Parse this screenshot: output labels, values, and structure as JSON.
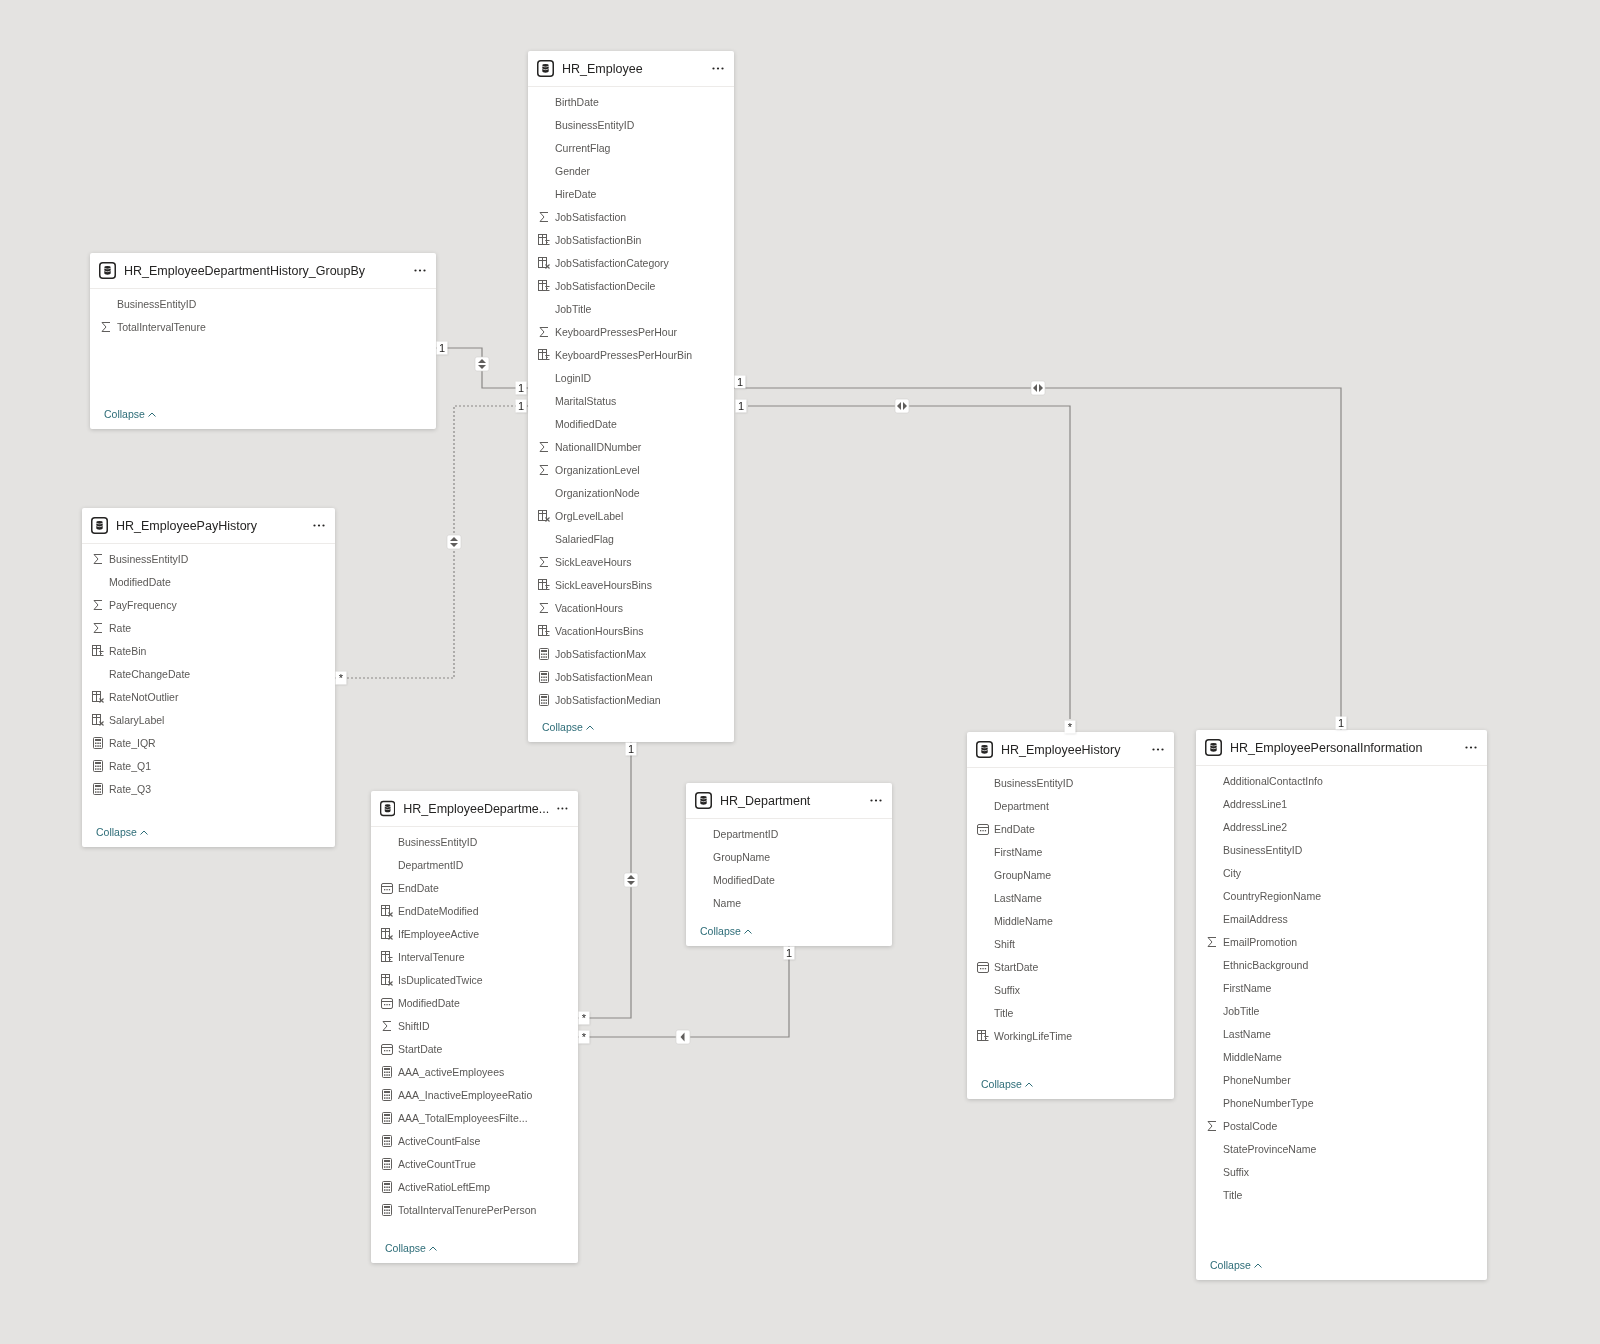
{
  "tables": [
    {
      "title": "HR_Employee",
      "collapse": "Collapse",
      "fields": [
        {
          "name": "BirthDate",
          "kind": "plain"
        },
        {
          "name": "BusinessEntityID",
          "kind": "plain"
        },
        {
          "name": "CurrentFlag",
          "kind": "plain"
        },
        {
          "name": "Gender",
          "kind": "plain"
        },
        {
          "name": "HireDate",
          "kind": "plain"
        },
        {
          "name": "JobSatisfaction",
          "kind": "sum"
        },
        {
          "name": "JobSatisfactionBin",
          "kind": "bin"
        },
        {
          "name": "JobSatisfactionCategory",
          "kind": "calc"
        },
        {
          "name": "JobSatisfactionDecile",
          "kind": "bin"
        },
        {
          "name": "JobTitle",
          "kind": "plain"
        },
        {
          "name": "KeyboardPressesPerHour",
          "kind": "sum"
        },
        {
          "name": "KeyboardPressesPerHourBin",
          "kind": "bin"
        },
        {
          "name": "LoginID",
          "kind": "plain"
        },
        {
          "name": "MaritalStatus",
          "kind": "plain"
        },
        {
          "name": "ModifiedDate",
          "kind": "plain"
        },
        {
          "name": "NationalIDNumber",
          "kind": "sum"
        },
        {
          "name": "OrganizationLevel",
          "kind": "sum"
        },
        {
          "name": "OrganizationNode",
          "kind": "plain"
        },
        {
          "name": "OrgLevelLabel",
          "kind": "calc"
        },
        {
          "name": "SalariedFlag",
          "kind": "plain"
        },
        {
          "name": "SickLeaveHours",
          "kind": "sum"
        },
        {
          "name": "SickLeaveHoursBins",
          "kind": "bin"
        },
        {
          "name": "VacationHours",
          "kind": "sum"
        },
        {
          "name": "VacationHoursBins",
          "kind": "bin"
        },
        {
          "name": "JobSatisfactionMax",
          "kind": "measure"
        },
        {
          "name": "JobSatisfactionMean",
          "kind": "measure"
        },
        {
          "name": "JobSatisfactionMedian",
          "kind": "measure"
        }
      ]
    },
    {
      "title": "HR_EmployeeDepartmentHistory_GroupBy",
      "collapse": "Collapse",
      "fields": [
        {
          "name": "BusinessEntityID",
          "kind": "plain"
        },
        {
          "name": "TotalIntervalTenure",
          "kind": "sum"
        }
      ]
    },
    {
      "title": "HR_EmployeePayHistory",
      "collapse": "Collapse",
      "fields": [
        {
          "name": "BusinessEntityID",
          "kind": "sum"
        },
        {
          "name": "ModifiedDate",
          "kind": "plain"
        },
        {
          "name": "PayFrequency",
          "kind": "sum"
        },
        {
          "name": "Rate",
          "kind": "sum"
        },
        {
          "name": "RateBin",
          "kind": "bin"
        },
        {
          "name": "RateChangeDate",
          "kind": "plain"
        },
        {
          "name": "RateNotOutlier",
          "kind": "calc"
        },
        {
          "name": "SalaryLabel",
          "kind": "calc"
        },
        {
          "name": "Rate_IQR",
          "kind": "measure"
        },
        {
          "name": "Rate_Q1",
          "kind": "measure"
        },
        {
          "name": "Rate_Q3",
          "kind": "measure"
        }
      ]
    },
    {
      "title": "HR_EmployeeDepartme...",
      "collapse": "Collapse",
      "fields": [
        {
          "name": "BusinessEntityID",
          "kind": "plain"
        },
        {
          "name": "DepartmentID",
          "kind": "plain"
        },
        {
          "name": "EndDate",
          "kind": "date"
        },
        {
          "name": "EndDateModified",
          "kind": "calc"
        },
        {
          "name": "IfEmployeeActive",
          "kind": "calc"
        },
        {
          "name": "IntervalTenure",
          "kind": "bin"
        },
        {
          "name": "IsDuplicatedTwice",
          "kind": "calc"
        },
        {
          "name": "ModifiedDate",
          "kind": "date"
        },
        {
          "name": "ShiftID",
          "kind": "sum"
        },
        {
          "name": "StartDate",
          "kind": "date"
        },
        {
          "name": "AAA_activeEmployees",
          "kind": "measure"
        },
        {
          "name": "AAA_InactiveEmployeeRatio",
          "kind": "measure"
        },
        {
          "name": "AAA_TotalEmployeesFilte...",
          "kind": "measure"
        },
        {
          "name": "ActiveCountFalse",
          "kind": "measure"
        },
        {
          "name": "ActiveCountTrue",
          "kind": "measure"
        },
        {
          "name": "ActiveRatioLeftEmp",
          "kind": "measure"
        },
        {
          "name": "TotalIntervalTenurePerPerson",
          "kind": "measure"
        }
      ]
    },
    {
      "title": "HR_Department",
      "collapse": "Collapse",
      "fields": [
        {
          "name": "DepartmentID",
          "kind": "plain"
        },
        {
          "name": "GroupName",
          "kind": "plain"
        },
        {
          "name": "ModifiedDate",
          "kind": "plain"
        },
        {
          "name": "Name",
          "kind": "plain"
        }
      ]
    },
    {
      "title": "HR_EmployeeHistory",
      "collapse": "Collapse",
      "fields": [
        {
          "name": "BusinessEntityID",
          "kind": "plain"
        },
        {
          "name": "Department",
          "kind": "plain"
        },
        {
          "name": "EndDate",
          "kind": "date"
        },
        {
          "name": "FirstName",
          "kind": "plain"
        },
        {
          "name": "GroupName",
          "kind": "plain"
        },
        {
          "name": "LastName",
          "kind": "plain"
        },
        {
          "name": "MiddleName",
          "kind": "plain"
        },
        {
          "name": "Shift",
          "kind": "plain"
        },
        {
          "name": "StartDate",
          "kind": "date"
        },
        {
          "name": "Suffix",
          "kind": "plain"
        },
        {
          "name": "Title",
          "kind": "plain"
        },
        {
          "name": "WorkingLifeTime",
          "kind": "bin"
        }
      ]
    },
    {
      "title": "HR_EmployeePersonalInformation",
      "collapse": "Collapse",
      "fields": [
        {
          "name": "AdditionalContactInfo",
          "kind": "plain"
        },
        {
          "name": "AddressLine1",
          "kind": "plain"
        },
        {
          "name": "AddressLine2",
          "kind": "plain"
        },
        {
          "name": "BusinessEntityID",
          "kind": "plain"
        },
        {
          "name": "City",
          "kind": "plain"
        },
        {
          "name": "CountryRegionName",
          "kind": "plain"
        },
        {
          "name": "EmailAddress",
          "kind": "plain"
        },
        {
          "name": "EmailPromotion",
          "kind": "sum"
        },
        {
          "name": "EthnicBackground",
          "kind": "plain"
        },
        {
          "name": "FirstName",
          "kind": "plain"
        },
        {
          "name": "JobTitle",
          "kind": "plain"
        },
        {
          "name": "LastName",
          "kind": "plain"
        },
        {
          "name": "MiddleName",
          "kind": "plain"
        },
        {
          "name": "PhoneNumber",
          "kind": "plain"
        },
        {
          "name": "PhoneNumberType",
          "kind": "plain"
        },
        {
          "name": "PostalCode",
          "kind": "sum"
        },
        {
          "name": "StateProvinceName",
          "kind": "plain"
        },
        {
          "name": "Suffix",
          "kind": "plain"
        },
        {
          "name": "Title",
          "kind": "plain"
        }
      ]
    }
  ],
  "relationships": [
    {
      "from_end": "1",
      "to_end": "1",
      "bidirectional": true,
      "active": true
    },
    {
      "from_end": "*",
      "to_end": "1",
      "bidirectional": true,
      "active": false
    },
    {
      "from_end": "1",
      "to_end": "1",
      "bidirectional": true,
      "active": true
    },
    {
      "from_end": "1",
      "to_end": "*",
      "bidirectional": true,
      "active": true
    },
    {
      "from_end": "1",
      "to_end": "*",
      "bidirectional": true,
      "active": true
    },
    {
      "from_end": "1",
      "to_end": "*",
      "bidirectional": false,
      "active": true
    }
  ]
}
